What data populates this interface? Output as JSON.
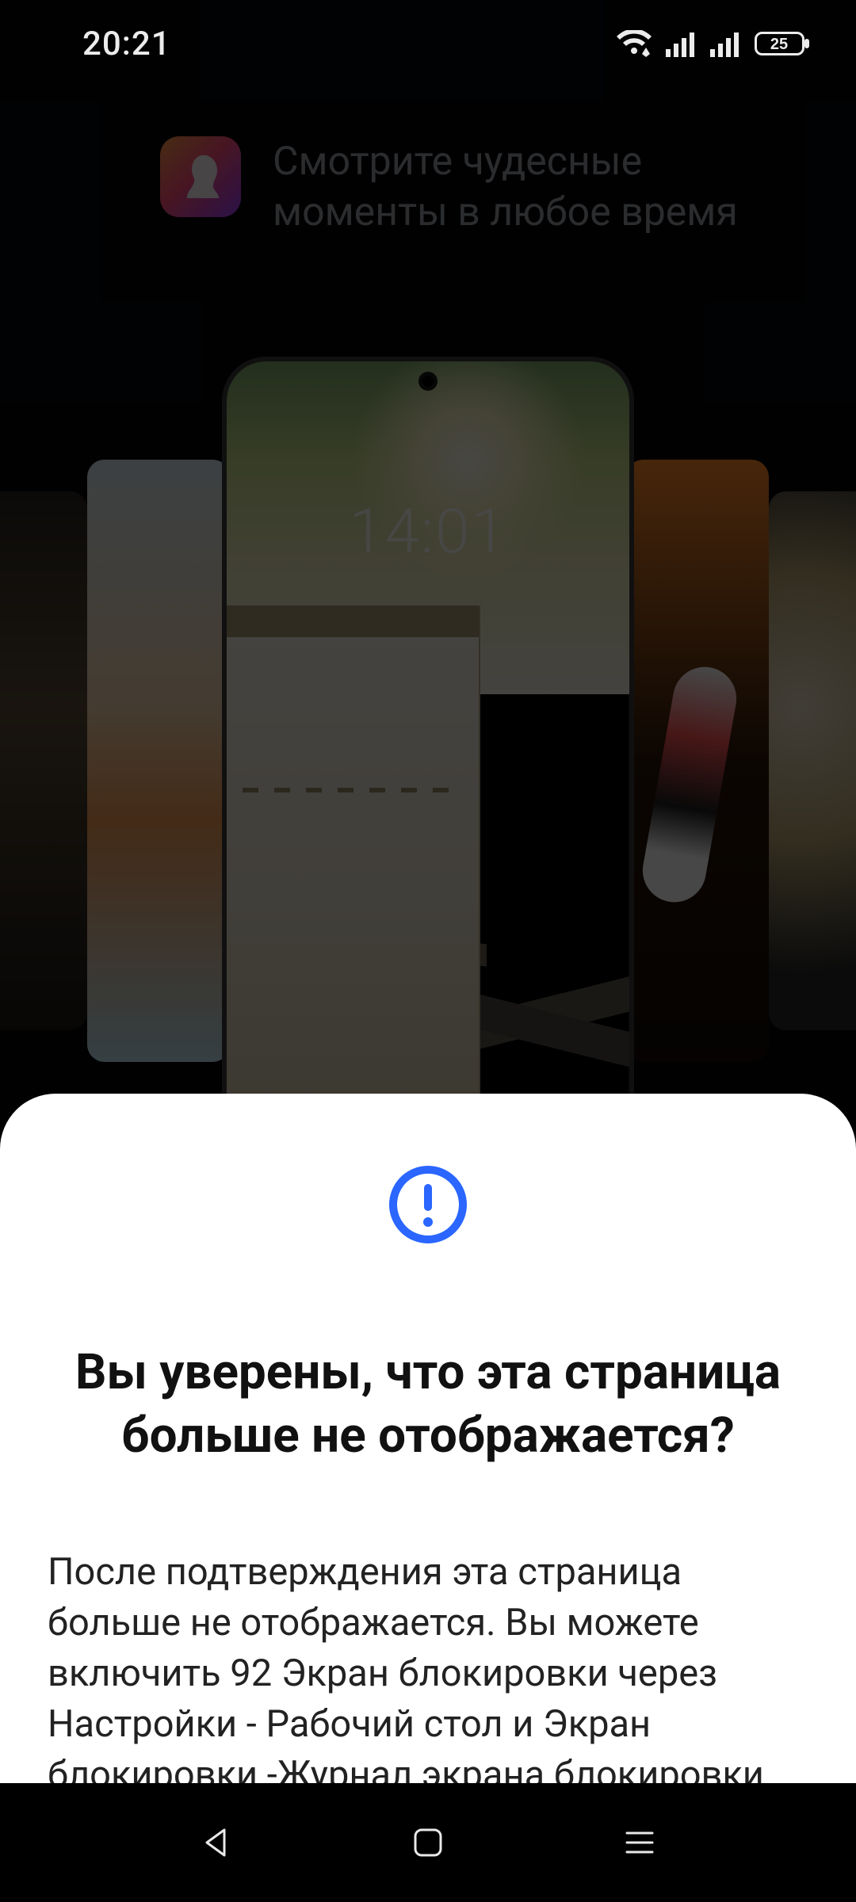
{
  "status": {
    "time": "20:21",
    "battery_percent": "25"
  },
  "promo": {
    "text": "Смотрите чудесные моменты в любое время"
  },
  "phone_preview": {
    "clock": "14:01"
  },
  "sheet": {
    "title": "Вы уверены, что эта страница больше не отображается?",
    "body": "После подтверждения эта страница больше не отображается. Вы можете включить 92 Экран блокировки через Настройки - Рабочий стол и Экран блокировки -Журнал экрана блокировки ."
  },
  "colors": {
    "accent": "#2a66ff"
  }
}
